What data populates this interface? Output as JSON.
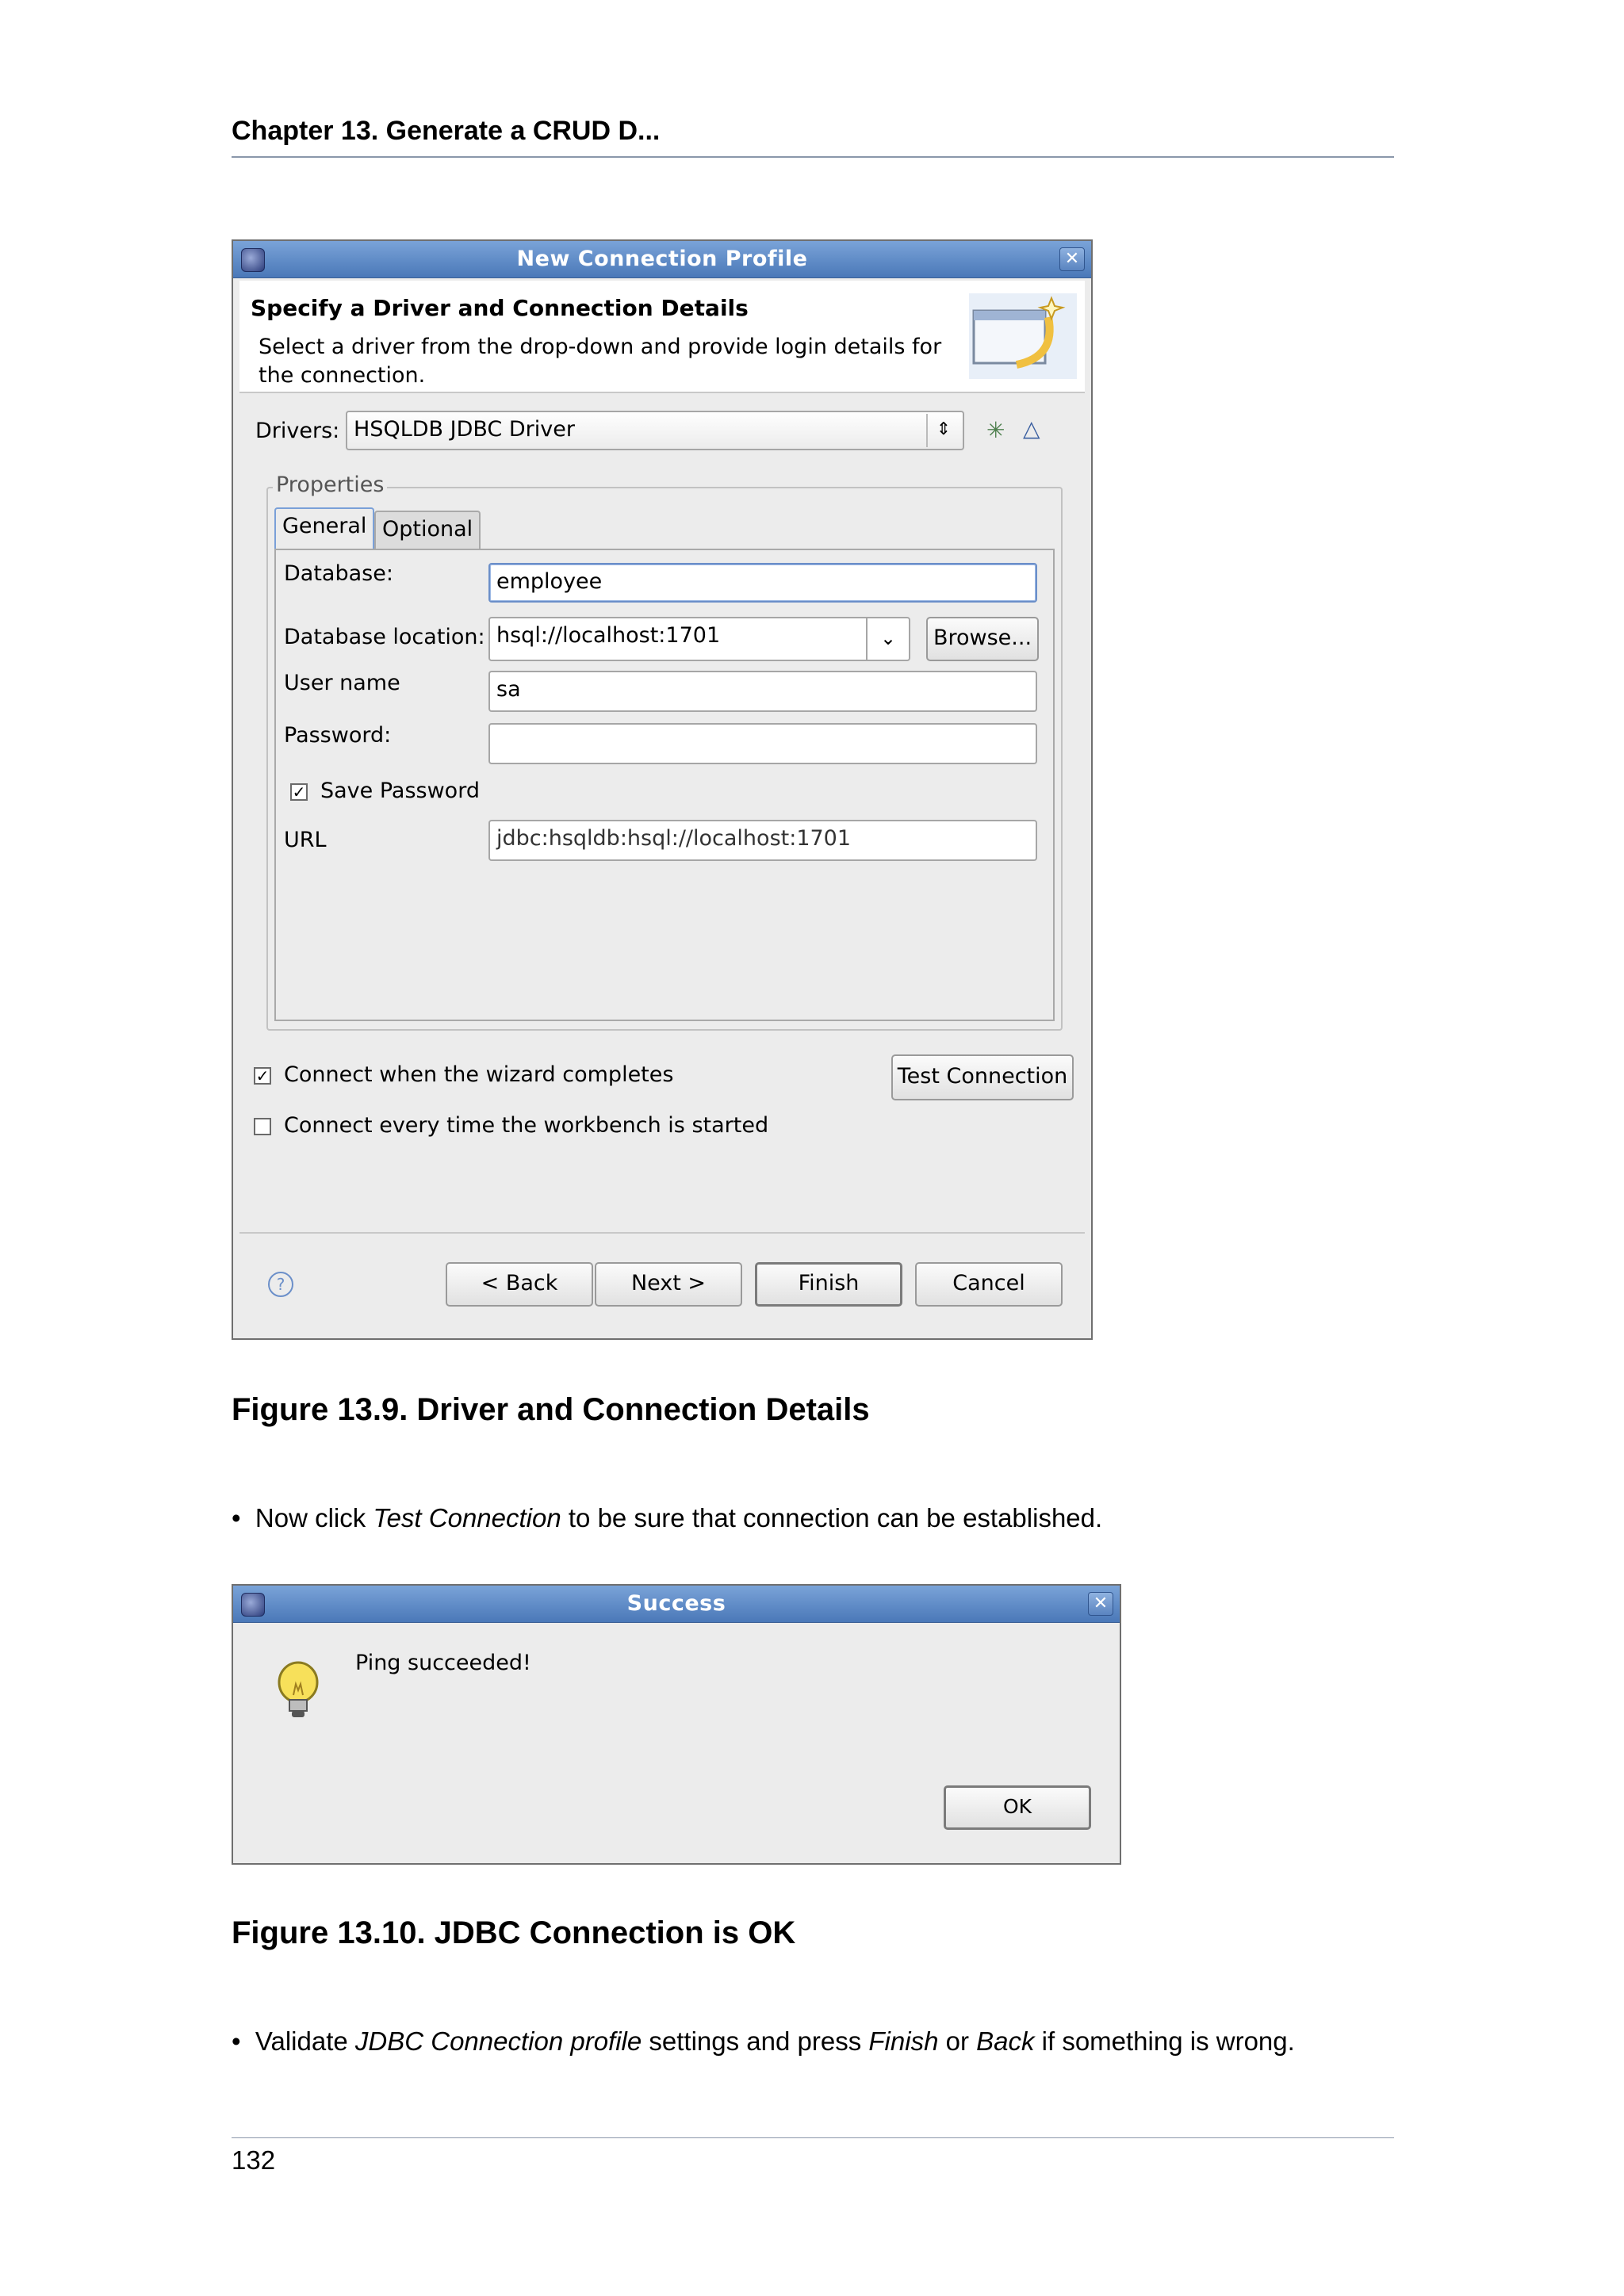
{
  "header": {
    "chapter": "Chapter 13. Generate a CRUD D..."
  },
  "dialog1": {
    "title": "New Connection Profile",
    "heading": "Specify a Driver and Connection Details",
    "desc_line1": "Select a driver from the drop-down and provide login details for",
    "desc_line2": "the connection.",
    "drivers_label": "Drivers:",
    "drivers_value": "HSQLDB JDBC Driver",
    "properties_label": "Properties",
    "tabs": {
      "general": "General",
      "optional": "Optional"
    },
    "database_label": "Database:",
    "database_value": "employee",
    "location_label": "Database location:",
    "location_value": "hsql://localhost:1701",
    "browse_label": "Browse...",
    "user_label": "User name",
    "user_value": "sa",
    "password_label": "Password:",
    "password_value": "",
    "save_password_label": "Save Password",
    "save_password_checked": "✓",
    "url_label": "URL",
    "url_value": "jdbc:hsqldb:hsql://localhost:1701",
    "connect_wizard_label": "Connect when the wizard completes",
    "connect_wizard_checked": "✓",
    "connect_every_label": "Connect every time the workbench is started",
    "test_connection_label": "Test Connection",
    "back_label": "< Back",
    "next_label": "Next >",
    "finish_label": "Finish",
    "cancel_label": "Cancel"
  },
  "figure1": {
    "caption": "Figure 13.9. Driver and Connection Details"
  },
  "bullet1": {
    "pre": "Now click ",
    "em": "Test Connection",
    "post": " to be sure that connection can be established."
  },
  "dialog2": {
    "title": "Success",
    "message": "Ping succeeded!",
    "ok_label": "OK"
  },
  "figure2": {
    "caption": "Figure 13.10. JDBC Connection is OK"
  },
  "bullet2": {
    "t1": "Validate ",
    "em1": "JDBC Connection profile",
    "t2": " settings and press ",
    "em2": "Finish",
    "t3": " or ",
    "em3": "Back",
    "t4": " if something is wrong."
  },
  "footer": {
    "page": "132"
  }
}
